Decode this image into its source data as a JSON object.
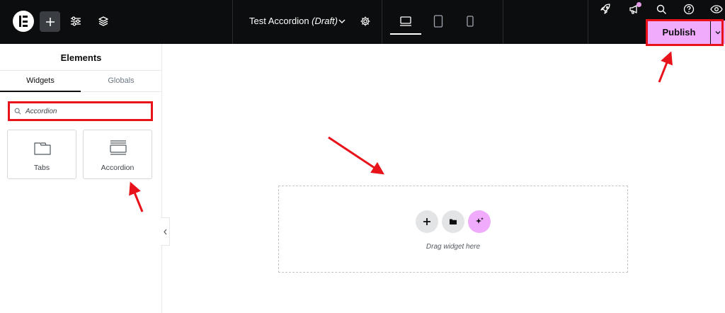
{
  "topbar": {
    "document_title": "Test Accordion",
    "document_status": "(Draft)",
    "publish_label": "Publish"
  },
  "sidebar": {
    "title": "Elements",
    "tabs": [
      {
        "label": "Widgets",
        "active": true
      },
      {
        "label": "Globals",
        "active": false
      }
    ],
    "search": {
      "value": "Accordion",
      "icon": "search-icon"
    },
    "widgets": [
      {
        "label": "Tabs",
        "icon": "tabs-icon"
      },
      {
        "label": "Accordion",
        "icon": "accordion-icon"
      }
    ]
  },
  "canvas": {
    "dropzone_text": "Drag widget here"
  },
  "colors": {
    "topbar_bg": "#0c0d0e",
    "accent_pink": "#f0abfc",
    "annotation_red": "#e8121a"
  }
}
